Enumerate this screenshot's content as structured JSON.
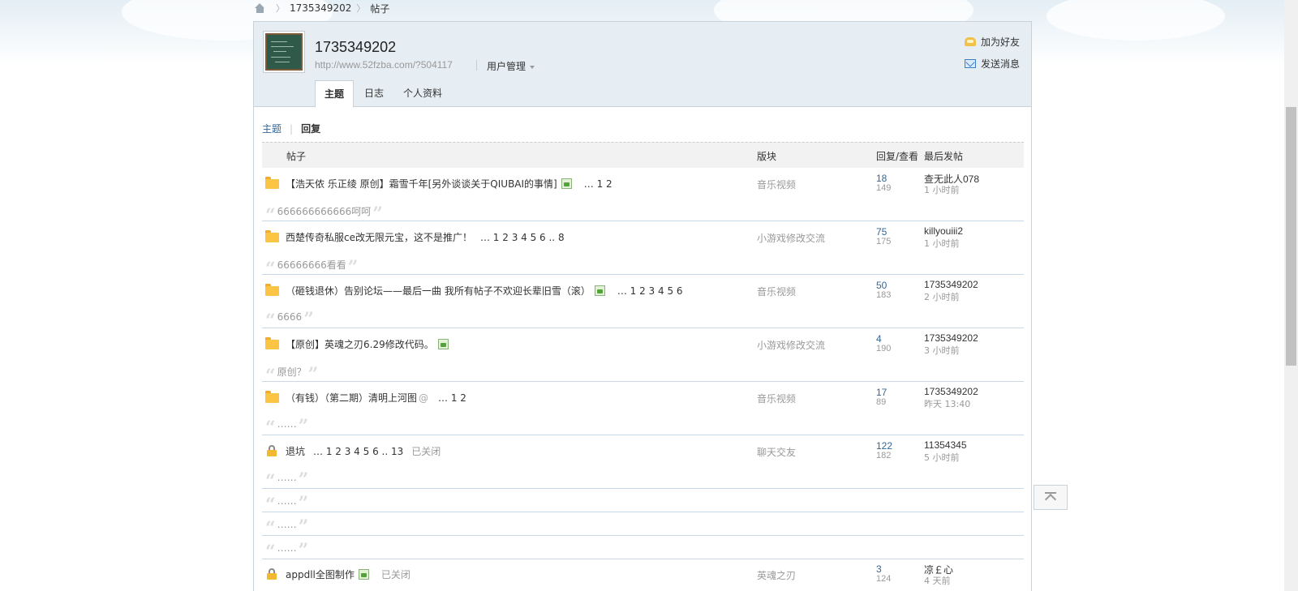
{
  "breadcrumb": {
    "user": "1735349202",
    "page": "帖子"
  },
  "profile": {
    "name": "1735349202",
    "url": "http://www.52fzba.com/?504117",
    "manage_label": "用户管理",
    "add_friend": "加为好友",
    "send_message": "发送消息",
    "tabs": [
      {
        "label": "主题",
        "active": true
      },
      {
        "label": "日志",
        "active": false
      },
      {
        "label": "个人资料",
        "active": false
      }
    ]
  },
  "subnav": {
    "topics": "主题",
    "replies": "回复"
  },
  "table": {
    "headers": {
      "post": "帖子",
      "forum": "版块",
      "reply_view": "回复/查看",
      "last": "最后发帖"
    },
    "rows": [
      {
        "icon": "folder",
        "title": "【浩天侬 乐正绫 原创】霜雪千年[另外谈谈关于QIUBAI的事情]",
        "has_image": true,
        "pages": "… 1 2",
        "closed": "",
        "forum": "音乐视频",
        "replies": "18",
        "views": "149",
        "last_user": "查无此人078",
        "last_time": "1 小时前",
        "quote": "666666666666呵呵"
      },
      {
        "icon": "folder",
        "title": "西楚传奇私服ce改无限元宝，这不是推广！",
        "has_image": false,
        "pages": "… 1 2 3 4 5 6 .. 8",
        "closed": "",
        "forum": "小游戏修改交流",
        "replies": "75",
        "views": "175",
        "last_user": "killyouiii2",
        "last_time": "1 小时前",
        "quote": "66666666看看"
      },
      {
        "icon": "folder",
        "title": "（砸钱退休）告别论坛——最后一曲 我所有帖子不欢迎长辈旧雪（滚）",
        "has_image": true,
        "pages": "… 1 2 3 4 5 6",
        "closed": "",
        "forum": "音乐视频",
        "replies": "50",
        "views": "183",
        "last_user": "1735349202",
        "last_time": "2 小时前",
        "quote": "6666"
      },
      {
        "icon": "folder",
        "title": "【原创】英魂之刃6.29修改代码。",
        "has_image": true,
        "pages": "",
        "closed": "",
        "forum": "小游戏修改交流",
        "replies": "4",
        "views": "190",
        "last_user": "1735349202",
        "last_time": "3 小时前",
        "quote": "原创？"
      },
      {
        "icon": "folder",
        "title": "（有钱）（第二期）清明上河图",
        "has_image": false,
        "attachment": "@",
        "pages": "… 1 2",
        "closed": "",
        "forum": "音乐视频",
        "replies": "17",
        "views": "89",
        "last_user": "1735349202",
        "last_time": "昨天 13:40",
        "quote": "……"
      },
      {
        "icon": "lock",
        "title": "退坑",
        "has_image": false,
        "pages": "… 1 2 3 4 5 6 .. 13",
        "closed": "已关闭",
        "forum": "聊天交友",
        "replies": "122",
        "views": "182",
        "last_user": "11354345",
        "last_time": "5 小时前",
        "quote": "……"
      }
    ],
    "extra_quotes": [
      "……",
      "……",
      "……"
    ],
    "last_row": {
      "icon": "lock",
      "title": "appdll全图制作",
      "has_image": true,
      "closed": "已关闭",
      "forum": "英魂之刃",
      "replies": "3",
      "views": "124",
      "last_user": "凉￡心",
      "last_time": "4 天前"
    }
  },
  "colors": {
    "link": "#336699",
    "muted": "#999999",
    "header_bg": "#e6edf3",
    "folder": "#fbc543"
  }
}
